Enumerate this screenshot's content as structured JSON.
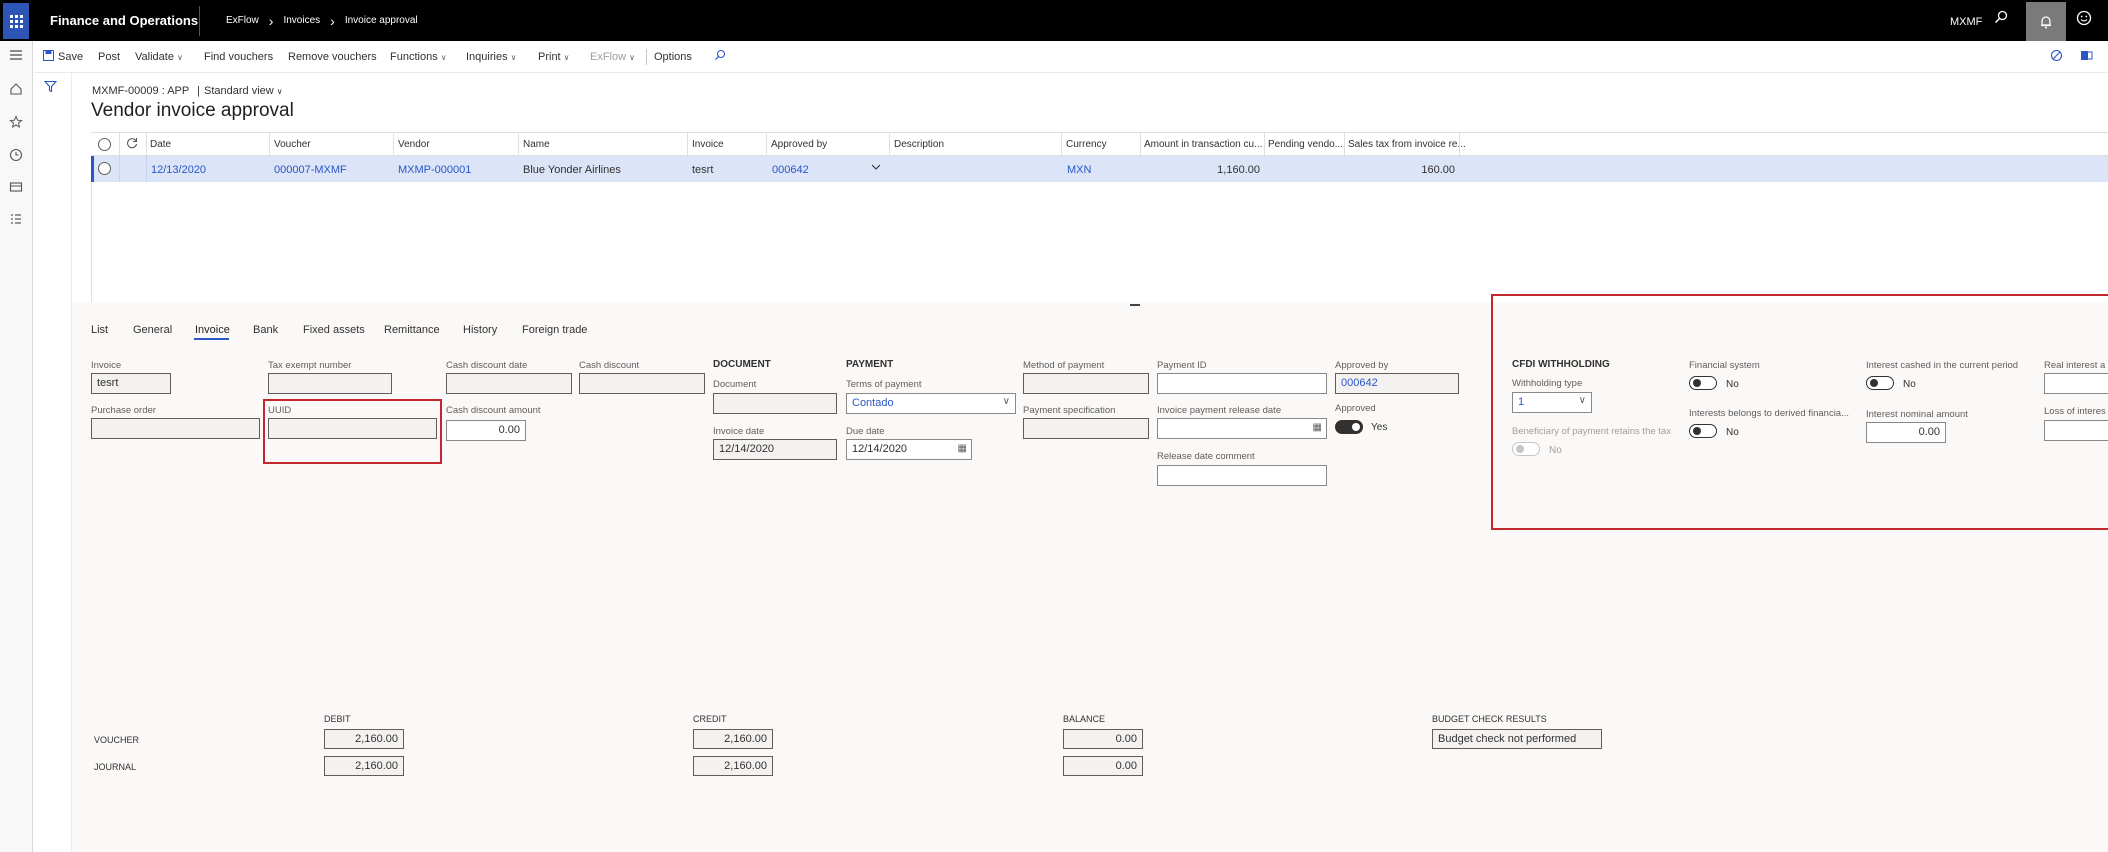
{
  "app": {
    "title": "Finance and Operations",
    "breadcrumb": [
      "ExFlow",
      "Invoices",
      "Invoice approval"
    ],
    "company": "MXMF"
  },
  "icons": {
    "waffle": "app-launcher-icon",
    "search": "search-icon",
    "bell": "bell-icon",
    "feedback": "smiley-icon",
    "rail": [
      "hamburger-icon",
      "home-icon",
      "star-icon",
      "clock-icon",
      "workspace-icon",
      "modules-icon"
    ]
  },
  "actions": [
    {
      "label": "Save",
      "icon": "save-icon"
    },
    {
      "label": "Post"
    },
    {
      "label": "Validate",
      "dropdown": true
    },
    {
      "label": "Find vouchers"
    },
    {
      "label": "Remove vouchers"
    },
    {
      "label": "Functions",
      "dropdown": true
    },
    {
      "label": "Inquiries",
      "dropdown": true
    },
    {
      "label": "Print",
      "dropdown": true
    },
    {
      "label": "ExFlow",
      "dropdown": true,
      "disabled": true
    },
    {
      "label": "Options"
    }
  ],
  "page": {
    "record_caption": "MXMF-00009 : APP",
    "separator": "|",
    "view_name": "Standard view",
    "title": "Vendor invoice approval"
  },
  "grid": {
    "columns": [
      "Date",
      "Voucher",
      "Vendor",
      "Name",
      "Invoice",
      "Approved by",
      "Description",
      "Currency",
      "Amount in transaction cu...",
      "Pending vendo...",
      "Sales tax from invoice re..."
    ],
    "rows": [
      {
        "date": "12/13/2020",
        "voucher": "000007-MXMF",
        "vendor": "MXMP-000001",
        "name": "Blue Yonder Airlines",
        "invoice": "tesrt",
        "approved_by": "000642",
        "description": "",
        "currency": "MXN",
        "amount": "1,160.00",
        "pending": "",
        "sales_tax": "160.00"
      }
    ]
  },
  "tabs": [
    "List",
    "General",
    "Invoice",
    "Bank",
    "Fixed assets",
    "Remittance",
    "History",
    "Foreign trade"
  ],
  "active_tab": "Invoice",
  "invoice_tab": {
    "invoice_label": "Invoice",
    "invoice_value": "tesrt",
    "purchase_order_label": "Purchase order",
    "purchase_order_value": "",
    "tax_exempt_label": "Tax exempt number",
    "tax_exempt_value": "",
    "uuid_label": "UUID",
    "uuid_value": "",
    "cash_discount_date_label": "Cash discount date",
    "cash_discount_date_value": "",
    "cash_discount_label": "Cash discount",
    "cash_discount_value": "",
    "cash_discount_amount_label": "Cash discount amount",
    "cash_discount_amount_value": "0.00",
    "document_section": "DOCUMENT",
    "document_label": "Document",
    "document_value": "",
    "invoice_date_label": "Invoice date",
    "invoice_date_value": "12/14/2020",
    "payment_section": "PAYMENT",
    "terms_label": "Terms of payment",
    "terms_value": "Contado",
    "due_date_label": "Due date",
    "due_date_value": "12/14/2020",
    "method_label": "Method of payment",
    "method_value": "",
    "payment_spec_label": "Payment specification",
    "payment_spec_value": "",
    "payment_id_label": "Payment ID",
    "payment_id_value": "",
    "release_date_label": "Invoice payment release date",
    "release_date_value": "",
    "release_comment_label": "Release date comment",
    "release_comment_value": "",
    "approved_by_label": "Approved by",
    "approved_by_value": "000642",
    "approved_label": "Approved",
    "approved_value": "Yes"
  },
  "cfdi": {
    "section": "CFDI WITHHOLDING",
    "withholding_type_label": "Withholding type",
    "withholding_type_value": "1",
    "beneficiary_label": "Beneficiary of payment retains the tax",
    "beneficiary_value": "No",
    "financial_system_label": "Financial system",
    "financial_system_value": "No",
    "interests_derived_label": "Interests belongs to derived financia...",
    "interests_derived_value": "No",
    "interest_cashed_label": "Interest cashed in the current period",
    "interest_cashed_value": "No",
    "interest_nominal_label": "Interest nominal amount",
    "interest_nominal_value": "0.00",
    "real_interest_label": "Real interest a",
    "loss_interest_label": "Loss of interes"
  },
  "totals": {
    "debit_label": "DEBIT",
    "credit_label": "CREDIT",
    "balance_label": "BALANCE",
    "budget_label": "BUDGET CHECK RESULTS",
    "voucher_label": "VOUCHER",
    "journal_label": "JOURNAL",
    "voucher_debit": "2,160.00",
    "voucher_credit": "2,160.00",
    "voucher_balance": "0.00",
    "journal_debit": "2,160.00",
    "journal_credit": "2,160.00",
    "journal_balance": "0.00",
    "budget_value": "Budget check not performed"
  },
  "colors": {
    "accent": "#2b56c9",
    "highlight": "#c4262e",
    "selected_row": "#dce4f8"
  }
}
